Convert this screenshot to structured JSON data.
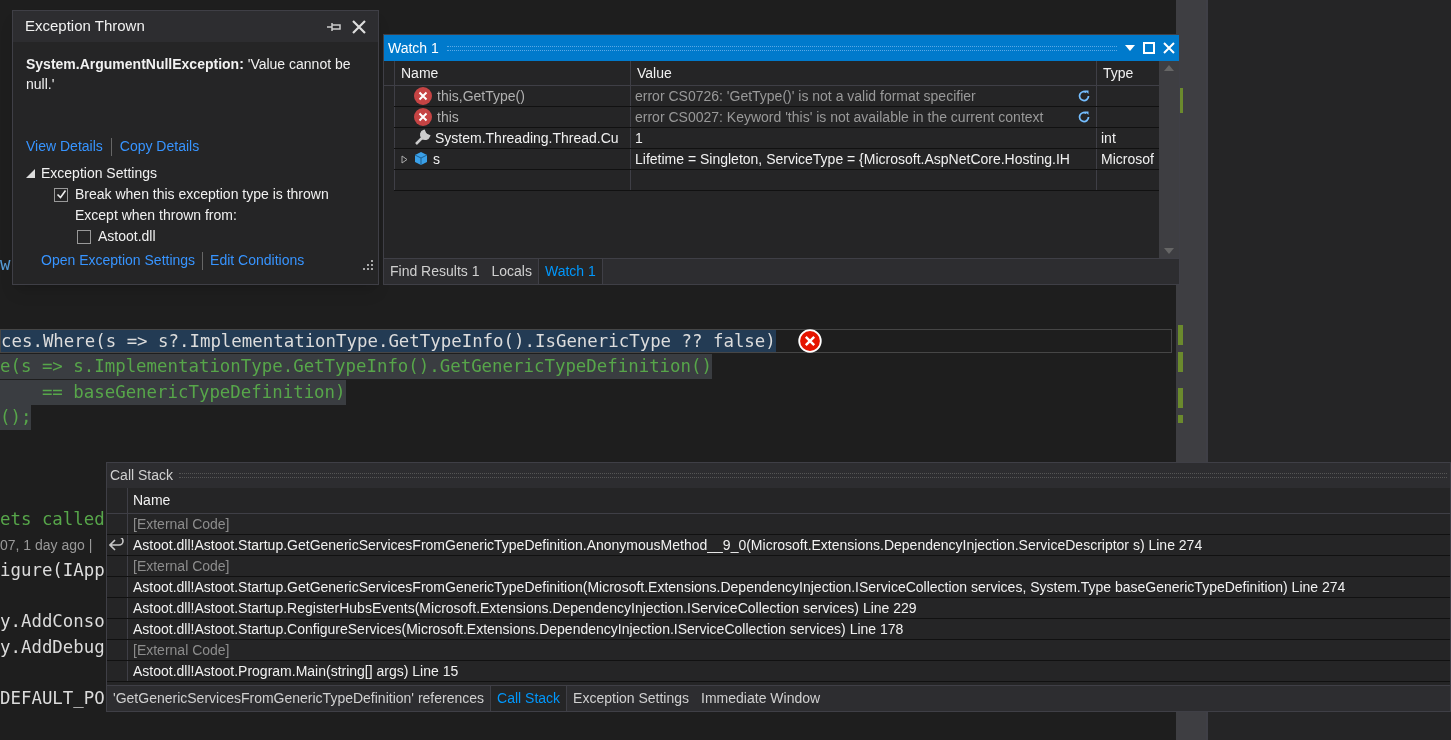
{
  "editor": {
    "lines": [
      {
        "text": "w",
        "kind": "link"
      },
      {
        "text": "ces.Where(s => s?.ImplementationType.GetTypeInfo().IsGenericType ?? false)",
        "kind": "current"
      },
      {
        "text": "e(s => s.ImplementationType.GetTypeInfo().GetGenericTypeDefinition()",
        "kind": "selected"
      },
      {
        "text": "    == baseGenericTypeDefinition)",
        "kind": "selected"
      },
      {
        "text": "();",
        "kind": "selected"
      },
      {
        "text": "ets called",
        "kind": "green"
      },
      {
        "text": "07, 1 day ago |",
        "kind": "lens"
      },
      {
        "text": "igure(IApp",
        "kind": "code"
      },
      {
        "text": "y.AddConso",
        "kind": "code"
      },
      {
        "text": "y.AddDebug",
        "kind": "code"
      },
      {
        "text": "DEFAULT_PO",
        "kind": "code"
      }
    ]
  },
  "exception_popup": {
    "title": "Exception Thrown",
    "message": "**System.ArgumentNullException:** 'Value cannot be null.'",
    "links": [
      "View Details",
      "Copy Details"
    ],
    "settings": {
      "label": "Exception Settings",
      "expanded": true,
      "break_option": {
        "label": "Break when this exception type is thrown",
        "checked": true
      },
      "except_label": "Except when thrown from:",
      "modules": [
        {
          "label": "Astoot.dll",
          "checked": false
        }
      ]
    },
    "bottom_links": [
      "Open Exception Settings",
      "Edit Conditions"
    ]
  },
  "watch": {
    "title": "Watch 1",
    "columns": [
      "Name",
      "Value",
      "Type"
    ],
    "rows": [
      {
        "kind": "error",
        "name": "this,GetType()",
        "value": "error CS0726: 'GetType()' is not a valid format specifier"
      },
      {
        "kind": "error",
        "name": "this",
        "value": "error CS0027: Keyword 'this' is not available in the current context"
      },
      {
        "kind": "property",
        "name": "System.Threading.Thread.Cu",
        "value": "1",
        "type": "int"
      },
      {
        "kind": "object",
        "name": "s",
        "value": "Lifetime = Singleton, ServiceType = {Microsoft.AspNetCore.Hosting.IH",
        "type": "Microsof",
        "expanded": false
      }
    ],
    "tabs": [
      {
        "label": "Find Results 1",
        "selected": false
      },
      {
        "label": "Locals",
        "selected": false
      },
      {
        "label": "Watch 1",
        "selected": true
      }
    ]
  },
  "call_stack": {
    "title": "Call Stack",
    "column": "Name",
    "rows": [
      {
        "kind": "external",
        "text": "[External Code]",
        "current": false
      },
      {
        "kind": "frame",
        "text": "Astoot.dll!Astoot.Startup.GetGenericServicesFromGenericTypeDefinition.AnonymousMethod__9_0(Microsoft.Extensions.DependencyInjection.ServiceDescriptor s) Line 274",
        "current": true
      },
      {
        "kind": "external",
        "text": "[External Code]",
        "current": false
      },
      {
        "kind": "frame",
        "text": "Astoot.dll!Astoot.Startup.GetGenericServicesFromGenericTypeDefinition(Microsoft.Extensions.DependencyInjection.IServiceCollection services, System.Type baseGenericTypeDefinition) Line 274",
        "current": false
      },
      {
        "kind": "frame",
        "text": "Astoot.dll!Astoot.Startup.RegisterHubsEvents(Microsoft.Extensions.DependencyInjection.IServiceCollection services) Line 229",
        "current": false
      },
      {
        "kind": "frame",
        "text": "Astoot.dll!Astoot.Startup.ConfigureServices(Microsoft.Extensions.DependencyInjection.IServiceCollection services) Line 178",
        "current": false
      },
      {
        "kind": "external",
        "text": "[External Code]",
        "current": false
      },
      {
        "kind": "frame",
        "text": "Astoot.dll!Astoot.Program.Main(string[] args) Line 15",
        "current": false
      }
    ],
    "tabs": [
      {
        "label": "'GetGenericServicesFromGenericTypeDefinition' references",
        "selected": false
      },
      {
        "label": "Call Stack",
        "selected": true
      },
      {
        "label": "Exception Settings",
        "selected": false
      },
      {
        "label": "Immediate Window",
        "selected": false
      }
    ]
  }
}
